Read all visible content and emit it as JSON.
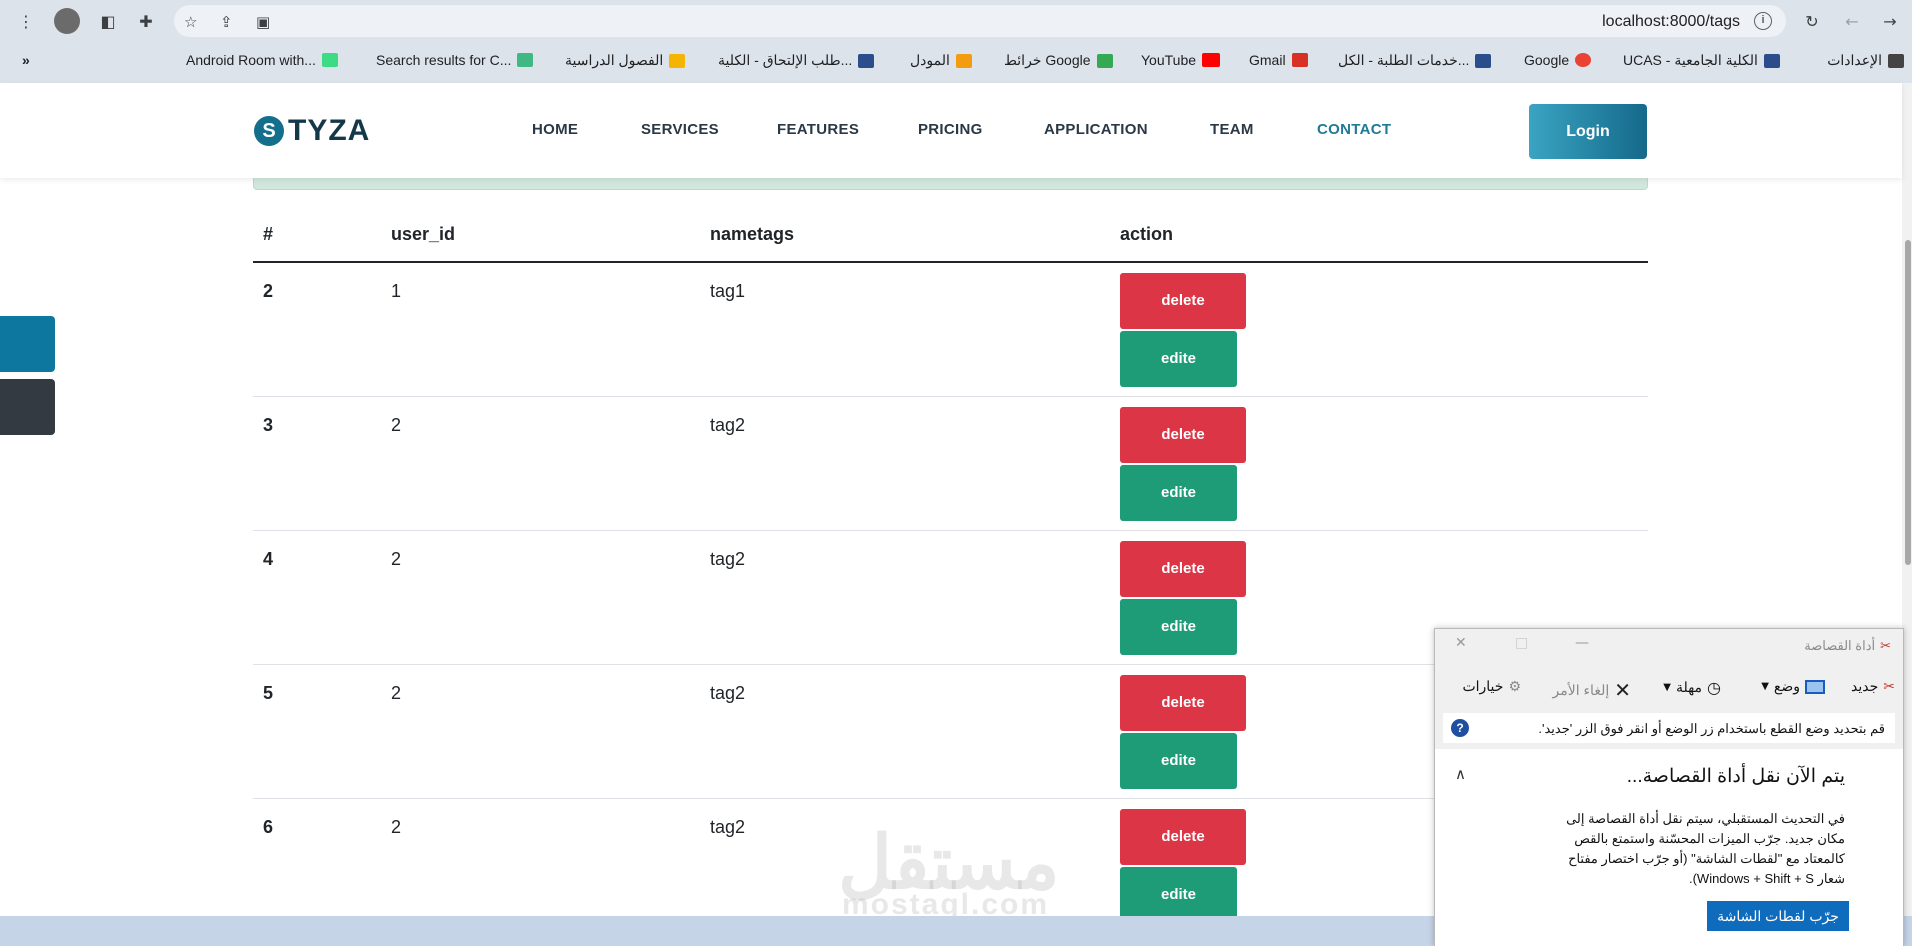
{
  "browser": {
    "url": "localhost:8000/tags",
    "bookmarks": [
      "الإعدادات",
      "UCAS - الكلية الجامعية",
      "Google",
      "خدمات الطلبة - الكل...",
      "Gmail",
      "YouTube",
      "خرائط Google",
      "المودل",
      "طلب الإلتحاق - الكلية...",
      "الفصول الدراسية",
      "Search results for C...",
      "Android Room with..."
    ],
    "more_label": "»"
  },
  "header": {
    "logo_mark": "S",
    "logo_text": "TYZA",
    "nav": [
      "HOME",
      "SERVICES",
      "FEATURES",
      "PRICING",
      "APPLICATION",
      "TEAM",
      "CONTACT"
    ],
    "active_nav": "CONTACT",
    "login_label": "Login"
  },
  "table": {
    "headers": [
      "#",
      "user_id",
      "nametags",
      "action"
    ],
    "rows": [
      {
        "id": "2",
        "user_id": "1",
        "nametag": "tag1"
      },
      {
        "id": "3",
        "user_id": "2",
        "nametag": "tag2"
      },
      {
        "id": "4",
        "user_id": "2",
        "nametag": "tag2"
      },
      {
        "id": "5",
        "user_id": "2",
        "nametag": "tag2"
      },
      {
        "id": "6",
        "user_id": "2",
        "nametag": "tag2"
      }
    ],
    "delete_label": "delete",
    "edit_label": "edite"
  },
  "watermark": {
    "ar": "مستقل",
    "en": "mostaql.com"
  },
  "snipping_tool": {
    "title": "أداة القصاصة",
    "toolbar": {
      "new": "جديد",
      "mode": "وضع",
      "delay": "مهلة",
      "cancel": "إلغاء الأمر",
      "options": "خيارات"
    },
    "hint": "قم بتحديد وضع القطع باستخدام زر الوضع أو انقر فوق الزر 'جديد'.",
    "heading": "يتم الآن نقل أداة القصاصة...",
    "body_lines": [
      "في التحديث المستقبلي، سيتم نقل أداة القصاصة إلى",
      "مكان جديد. جرّب الميزات المحسّنة واستمتع بالقص",
      "كالمعتاد مع \"لقطات الشاشة\" (أو جرّب اختصار مفتاح",
      "شعار Windows + Shift + S)."
    ],
    "cta": "جرّب لقطات الشاشة"
  },
  "colors": {
    "accent": "#1e7a96",
    "delete": "#dc3545",
    "edit": "#1e9c78",
    "login_gradient_start": "#3aa4c2",
    "login_gradient_end": "#15698a"
  }
}
